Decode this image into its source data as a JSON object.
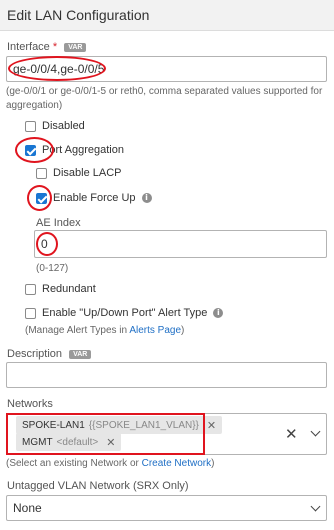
{
  "header": {
    "title": "Edit LAN Configuration"
  },
  "interface": {
    "label": "Interface",
    "required_mark": "*",
    "badge": "VAR",
    "value": "ge-0/0/4,ge-0/0/5",
    "hint": "(ge-0/0/1 or ge-0/0/1-5 or reth0, comma separated values supported for aggregation)"
  },
  "options": {
    "disabled": {
      "label": "Disabled",
      "checked": false
    },
    "port_aggregation": {
      "label": "Port Aggregation",
      "checked": true
    },
    "disable_lacp": {
      "label": "Disable LACP",
      "checked": false
    },
    "enable_force_up": {
      "label": "Enable Force Up",
      "checked": true,
      "icon": "info-icon"
    }
  },
  "ae_index": {
    "label": "AE Index",
    "value": "0",
    "hint": "(0-127)"
  },
  "redundant": {
    "label": "Redundant",
    "checked": false
  },
  "alert_type": {
    "label": "Enable \"Up/Down Port\" Alert Type",
    "checked": false,
    "icon": "info-icon",
    "hint_prefix": "(Manage Alert Types in ",
    "hint_link": "Alerts Page",
    "hint_suffix": ")"
  },
  "description": {
    "label": "Description",
    "badge": "VAR",
    "value": ""
  },
  "networks": {
    "label": "Networks",
    "chips": [
      {
        "name": "SPOKE-LAN1",
        "detail": "{{SPOKE_LAN1_VLAN}}"
      },
      {
        "name": "MGMT",
        "detail": "<default>"
      }
    ],
    "hint_prefix": "(Select an existing Network or ",
    "hint_link": "Create Network",
    "hint_suffix": ")"
  },
  "untagged_vlan": {
    "label": "Untagged VLAN Network (SRX Only)",
    "value": "None"
  },
  "colors": {
    "accent": "#1976d2",
    "annotation": "#e0141e",
    "link": "#1f6fc5"
  }
}
